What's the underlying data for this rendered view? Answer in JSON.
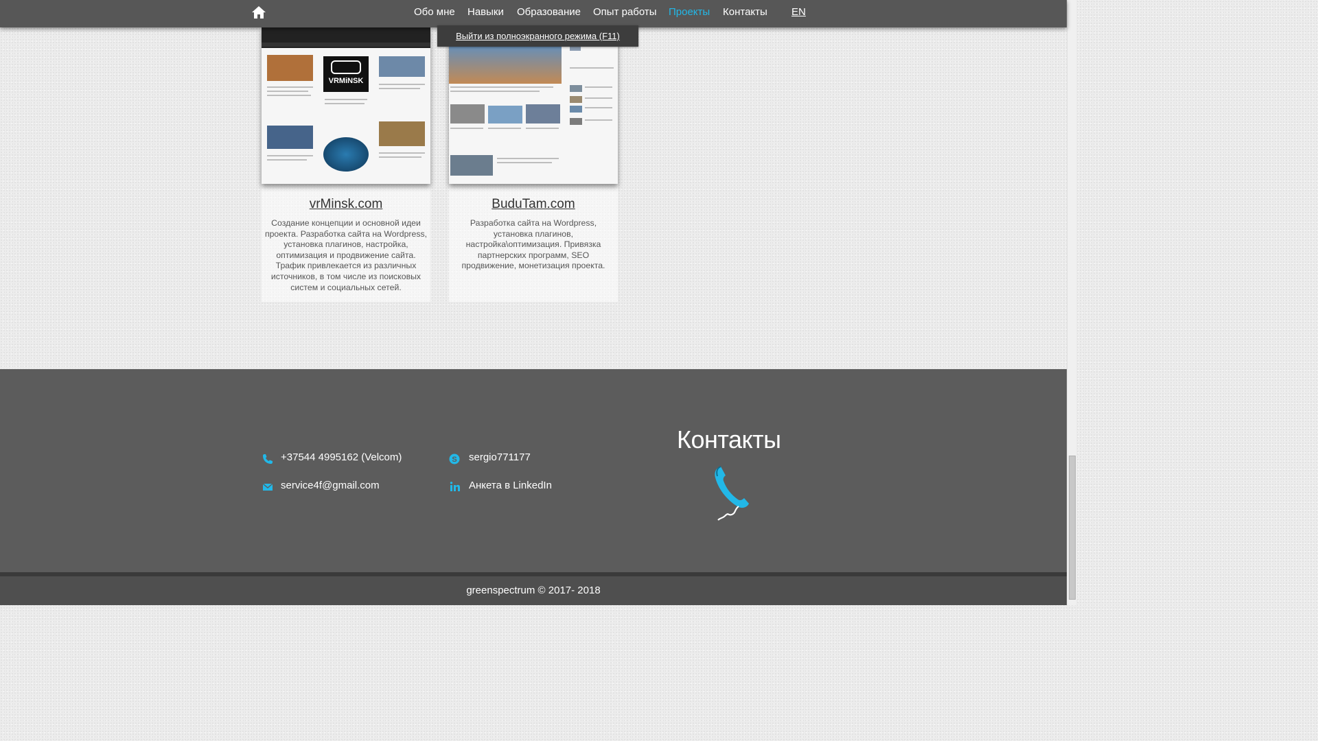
{
  "nav": {
    "items": [
      "Обо мне",
      "Навыки",
      "Образование",
      "Опыт работы",
      "Проекты",
      "Контакты"
    ],
    "active": "Проекты",
    "lang": "EN"
  },
  "fullscreen_tooltip": "Выйти из полноэкранного режима (F11)",
  "projects": [
    {
      "title": "vrMinsk.com",
      "description": "Создание концепции и основной идеи проекта. Разработка сайта на Wordpress, установка плагинов, настройка, оптимизация и продвижение сайта. Трафик привлекается из различных источников, в том числе из поисковых систем и социальных сетей.",
      "logo_text": "VRMiNSK"
    },
    {
      "title": "BuduTam.com",
      "description": "Разработка сайта на Wordpress, установка плагинов, настройка\\оптимизация. Привязка партнерских программ, SEO продвижение, монетизация проекта."
    }
  ],
  "contacts": {
    "heading": "Контакты",
    "phone": "+37544 4995162 (Velcom)",
    "email": "service4f@gmail.com",
    "skype": "sergio771177",
    "linkedin": "Анкета в LinkedIn"
  },
  "footer": {
    "copyright": "greenspectrum © 2017- 2018"
  },
  "colors": {
    "accent": "#22b8e8",
    "nav_bg": "#575757",
    "footer_bg": "#5c5c5c"
  }
}
